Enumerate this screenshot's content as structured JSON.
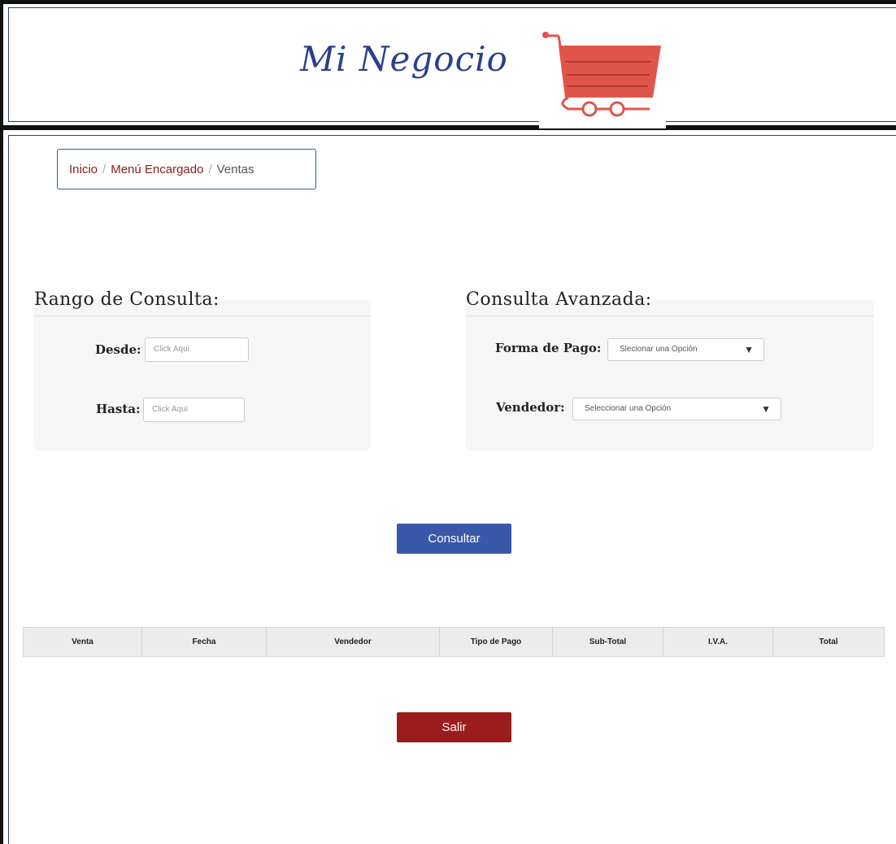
{
  "header": {
    "brand": "Mi Negocio",
    "logo_icon": "shopping-cart-icon",
    "cart_color": "#e0554a"
  },
  "breadcrumb": {
    "items": [
      "Inicio",
      "Menú Encargado",
      "Ventas"
    ],
    "separator": "/"
  },
  "rango": {
    "title": "Rango de Consulta:",
    "desde_label": "Desde:",
    "desde_placeholder": "Click Aqui",
    "hasta_label": "Hasta:",
    "hasta_placeholder": "Click Aqui"
  },
  "avanzada": {
    "title": "Consulta Avanzada:",
    "pago_label": "Forma de Pago:",
    "pago_value": "Slecionar una Opción",
    "vendedor_label": "Vendedor:",
    "vendedor_value": "Seleccionar una Opción"
  },
  "buttons": {
    "consultar": "Consultar",
    "salir": "Salir"
  },
  "table": {
    "columns": [
      "Venta",
      "Fecha",
      "Vendedor",
      "Tipo de Pago",
      "Sub-Total",
      "I.V.A.",
      "Total"
    ]
  },
  "colors": {
    "primary": "#3a57a8",
    "danger": "#9b1c1c",
    "brand": "#2a3f8f"
  }
}
